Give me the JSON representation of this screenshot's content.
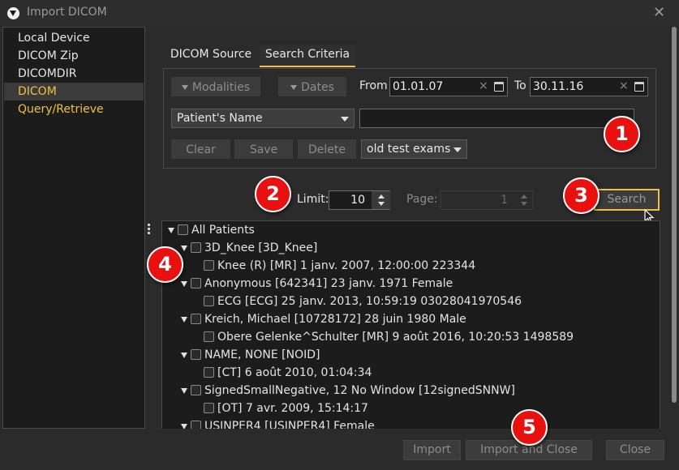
{
  "window": {
    "title": "Import DICOM",
    "close_icon": "close-icon"
  },
  "sources": [
    "Local Device",
    "DICOM Zip",
    "DICOMDIR",
    "DICOM Query/Retrieve"
  ],
  "selected_source": "DICOM Query/Retrieve",
  "tabs": [
    "DICOM Source",
    "Search Criteria"
  ],
  "active_tab": "Search Criteria",
  "criteria": {
    "modalities_label": "Modalities",
    "dates_label": "Dates",
    "from_label": "From",
    "from_value": "01.01.07",
    "to_label": "To",
    "to_value": "30.11.16",
    "clear_glyph": "×",
    "field_select": "Patient's Name",
    "field_value": "",
    "clear_label": "Clear",
    "save_label": "Save",
    "delete_label": "Delete",
    "preset_select": "old test exams"
  },
  "search": {
    "limit_label": "Limit:",
    "limit_value": "10",
    "page_label": "Page:",
    "page_value": "1",
    "search_label": "Search"
  },
  "tree": [
    {
      "level": 0,
      "expanded": true,
      "text": "All Patients"
    },
    {
      "level": 1,
      "expanded": true,
      "text": "3D_Knee [3D_Knee]"
    },
    {
      "level": 2,
      "expanded": false,
      "text": "Knee (R) [MR] 1 janv. 2007, 12:00:00 223344"
    },
    {
      "level": 1,
      "expanded": true,
      "text": "Anonymous [642341] 23 janv. 1971 Female"
    },
    {
      "level": 2,
      "expanded": false,
      "text": "ECG [ECG] 25 janv. 2013, 10:59:19 03028041970546"
    },
    {
      "level": 1,
      "expanded": true,
      "text": "Kreich, Michael [10728172] 28 juin 1980 Male"
    },
    {
      "level": 2,
      "expanded": false,
      "text": "Obere Gelenke^Schulter [MR] 9 août 2016, 10:20:53 1498589"
    },
    {
      "level": 1,
      "expanded": true,
      "text": "NAME, NONE [NOID]"
    },
    {
      "level": 2,
      "expanded": false,
      "text": " [CT] 6 août 2010, 01:04:34"
    },
    {
      "level": 1,
      "expanded": true,
      "text": "SignedSmallNegative, 12 No Window [12signedSNNW]"
    },
    {
      "level": 2,
      "expanded": false,
      "text": " [OT] 7 avr. 2009, 15:14:17"
    },
    {
      "level": 1,
      "expanded": true,
      "text": "USINPER4 [USINPER4]  Female"
    }
  ],
  "buttons": {
    "import": "Import",
    "import_close": "Import and Close",
    "close": "Close"
  },
  "markers": [
    "1",
    "2",
    "3",
    "4",
    "5"
  ],
  "colors": {
    "accent": "#f0c040",
    "marker": "#e8110f",
    "background": "#2b2b2b",
    "field": "#1c1c1c"
  }
}
